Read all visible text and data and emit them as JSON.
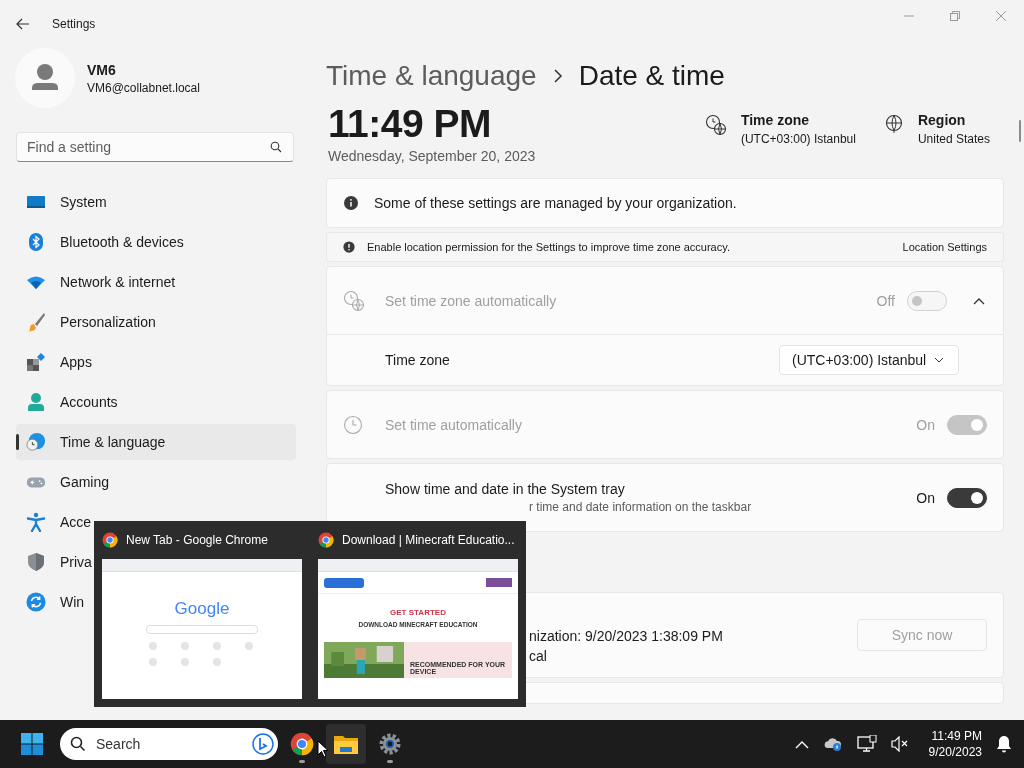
{
  "window": {
    "title": "Settings"
  },
  "user": {
    "name": "VM6",
    "email": "VM6@collabnet.local"
  },
  "search": {
    "placeholder": "Find a setting"
  },
  "nav": [
    {
      "label": "System",
      "kind": "system",
      "selected": false
    },
    {
      "label": "Bluetooth & devices",
      "kind": "bluetooth",
      "selected": false
    },
    {
      "label": "Network & internet",
      "kind": "wifi",
      "selected": false
    },
    {
      "label": "Personalization",
      "kind": "brush",
      "selected": false
    },
    {
      "label": "Apps",
      "kind": "apps",
      "selected": false
    },
    {
      "label": "Accounts",
      "kind": "person",
      "selected": false
    },
    {
      "label": "Time & language",
      "kind": "time",
      "selected": true
    },
    {
      "label": "Gaming",
      "kind": "gamepad",
      "selected": false
    },
    {
      "label": "Acce",
      "kind": "accessibility",
      "selected": false
    },
    {
      "label": "Priva",
      "kind": "shield",
      "selected": false
    },
    {
      "label": "Win",
      "kind": "update",
      "selected": false
    }
  ],
  "breadcrumb": {
    "parent": "Time & language",
    "current": "Date & time"
  },
  "clock": {
    "time": "11:49 PM",
    "date": "Wednesday, September 20, 2023"
  },
  "summary": [
    {
      "kind": "timezone",
      "label": "Time zone",
      "value": "(UTC+03:00) Istanbul"
    },
    {
      "kind": "region",
      "label": "Region",
      "value": "United States"
    }
  ],
  "notice": "Some of these settings are managed by your organization.",
  "location_bar": {
    "text": "Enable location permission for the Settings to improve time zone accuracy.",
    "link": "Location Settings"
  },
  "settings": [
    {
      "kind": "toggle",
      "title": "Set time zone automatically",
      "state": "Off",
      "on": false,
      "disabled": true,
      "expanded": true,
      "children": [
        {
          "kind": "dropdown",
          "title": "Time zone",
          "value": "(UTC+03:00) Istanbul"
        }
      ]
    },
    {
      "kind": "toggle",
      "title": "Set time automatically",
      "state": "On",
      "on": true,
      "disabled": true
    },
    {
      "kind": "toggle",
      "title": "Show time and date in the System tray",
      "subtitle": "r time and date information on the taskbar",
      "state": "On",
      "on": true,
      "disabled": false
    }
  ],
  "sync": {
    "lines": [
      "nization: 9/20/2023 1:38:09 PM",
      "cal"
    ],
    "button": "Sync now",
    "disabled": true
  },
  "previews": [
    {
      "kind": "newtab",
      "title": "New Tab - Google Chrome",
      "logo": "Google"
    },
    {
      "kind": "download",
      "title": "Download | Minecraft Educatio...",
      "heading": "GET STARTED",
      "subheading": "DOWNLOAD MINECRAFT EDUCATION",
      "card": "RECOMMENDED FOR YOUR DEVICE"
    }
  ],
  "taskbar": {
    "search_placeholder": "Search",
    "apps": [
      {
        "kind": "chrome",
        "running": true,
        "selected": false
      },
      {
        "kind": "folder",
        "running": false,
        "selected": true
      },
      {
        "kind": "gear",
        "running": true,
        "selected": false
      }
    ],
    "time": "11:49 PM",
    "date": "9/20/2023"
  }
}
